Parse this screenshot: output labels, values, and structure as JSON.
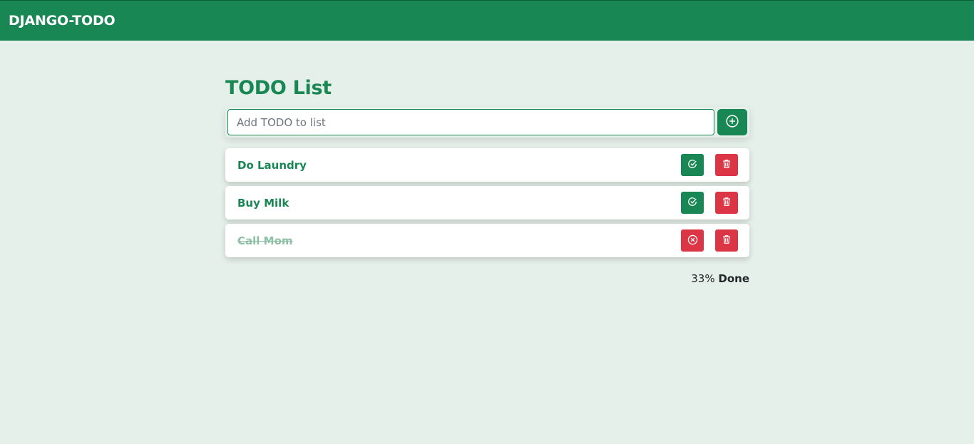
{
  "navbar": {
    "brand": "DJANGO-TODO"
  },
  "main": {
    "title": "TODO List",
    "input": {
      "placeholder": "Add TODO to list",
      "value": ""
    },
    "add_button_icon": "plus-circle-icon"
  },
  "todos": [
    {
      "label": "Do Laundry",
      "done": false,
      "toggle_icon": "check-circle-icon",
      "delete_icon": "trash-icon"
    },
    {
      "label": "Buy Milk",
      "done": false,
      "toggle_icon": "check-circle-icon",
      "delete_icon": "trash-icon"
    },
    {
      "label": "Call Mom",
      "done": true,
      "toggle_icon": "x-circle-icon",
      "delete_icon": "trash-icon"
    }
  ],
  "summary": {
    "percent": "33%",
    "label": "Done"
  },
  "colors": {
    "primary": "#198754",
    "danger": "#dc3545",
    "background": "#e6f0ea"
  }
}
